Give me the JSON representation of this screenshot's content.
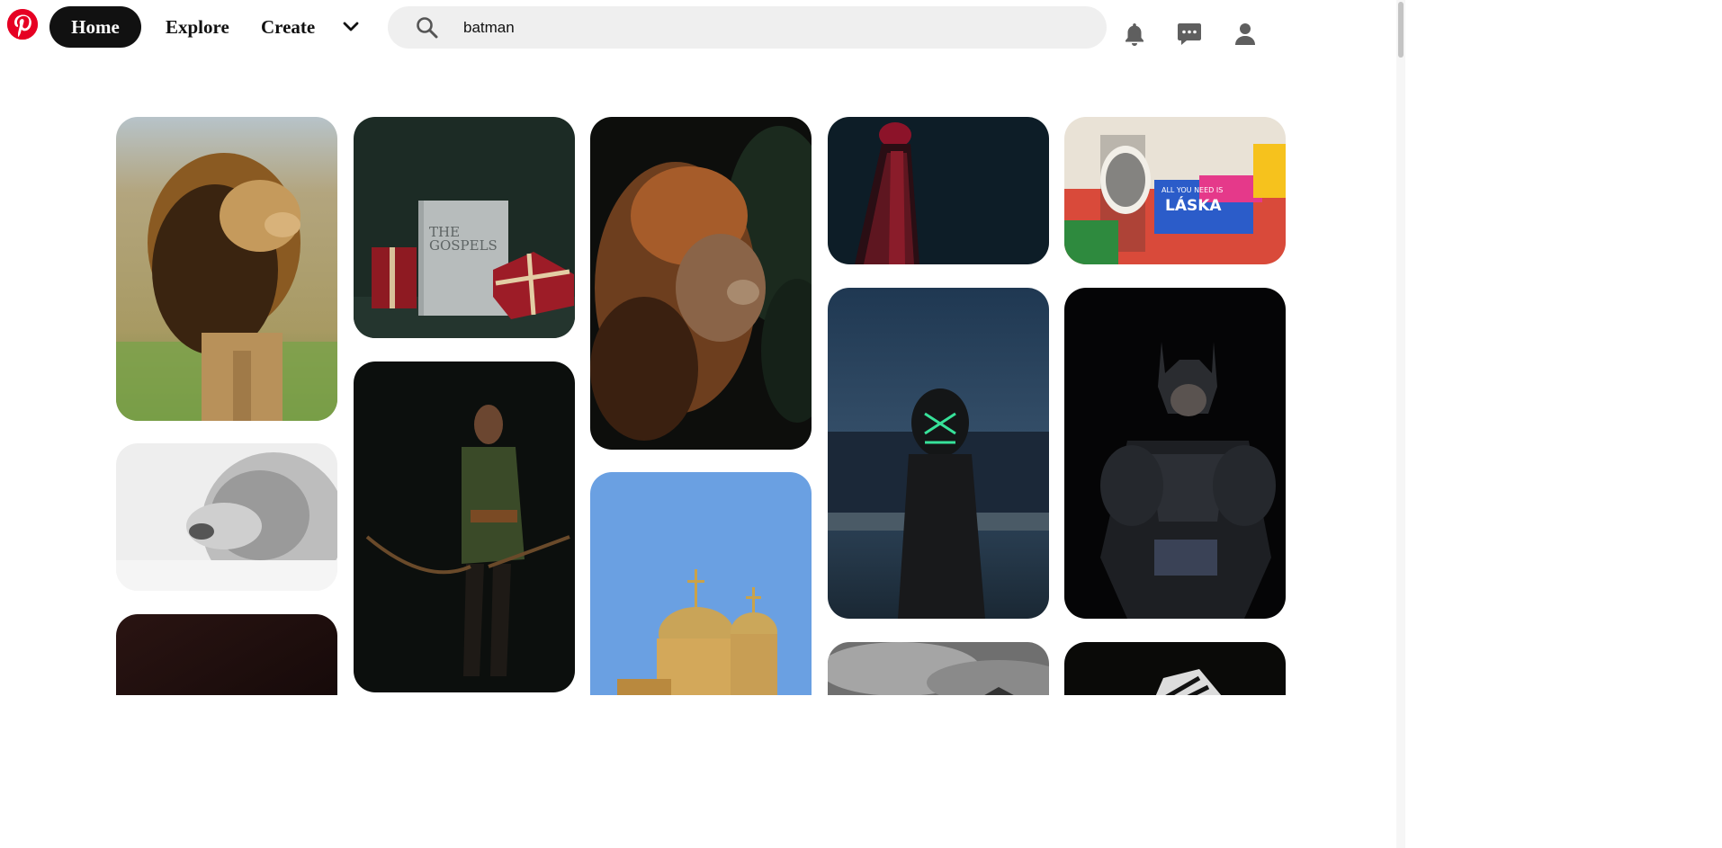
{
  "header": {
    "logo_icon": "pinterest-logo",
    "nav": {
      "home_label": "Home",
      "explore_label": "Explore",
      "create_label": "Create",
      "more_icon": "chevron-down-icon"
    },
    "search": {
      "icon": "search-icon",
      "value": "batman"
    },
    "icons": [
      "bell-icon",
      "chat-icon",
      "user-icon"
    ]
  },
  "pins": [
    {
      "name": "lion-roaring-field",
      "column": 1
    },
    {
      "name": "lion-black-white",
      "column": 1
    },
    {
      "name": "dark-red-pin",
      "column": 1
    },
    {
      "name": "gospels-book-gifts",
      "column": 2,
      "book_title": "THE\nGOSPELS"
    },
    {
      "name": "archer-man-dark",
      "column": 2
    },
    {
      "name": "lion-dark-leaves",
      "column": 3
    },
    {
      "name": "church-domes-blue-sky",
      "column": 3
    },
    {
      "name": "red-tower-night",
      "column": 4
    },
    {
      "name": "neon-mask-hoodie-city",
      "column": 4
    },
    {
      "name": "cloudy-sky-mountains",
      "column": 4
    },
    {
      "name": "lennon-graffiti-wall",
      "column": 5,
      "graffiti_text": [
        "ALL YOU NEED IS",
        "LÁSKA"
      ]
    },
    {
      "name": "batman-figure",
      "column": 5
    },
    {
      "name": "zebra-dark",
      "column": 5
    }
  ],
  "colors": {
    "brand": "#e60023",
    "nav_active_bg": "#111111",
    "search_bg": "#efefef"
  }
}
